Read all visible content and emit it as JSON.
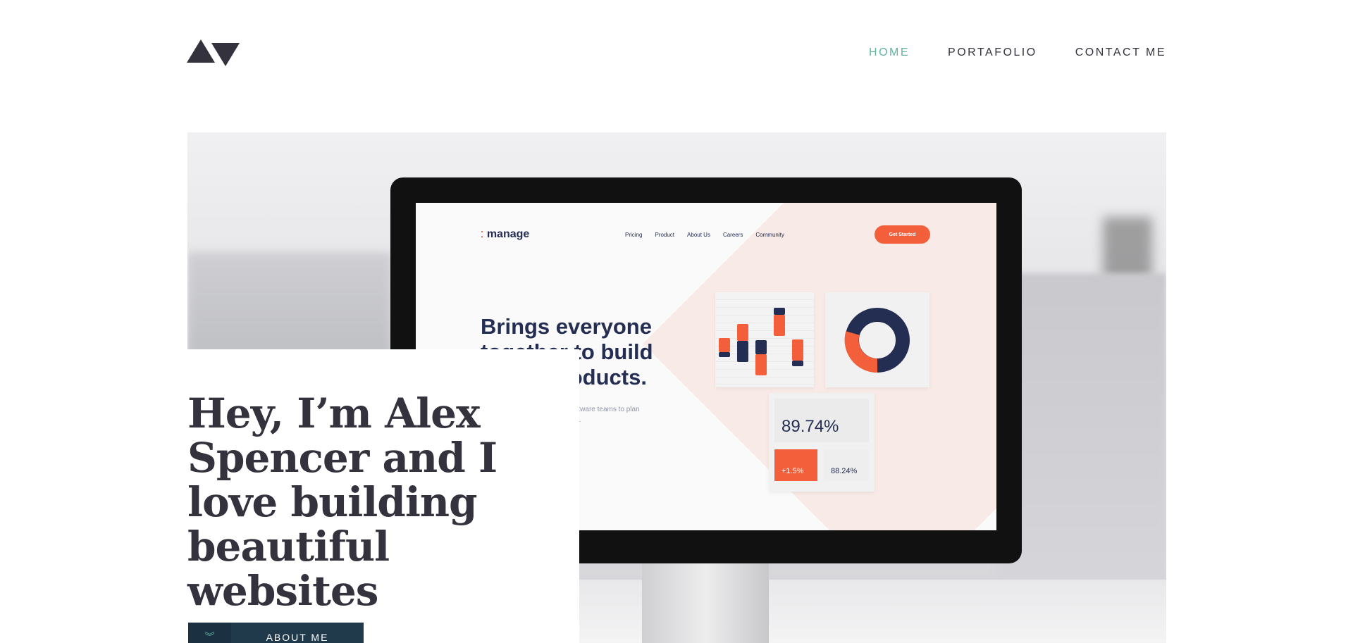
{
  "nav": {
    "items": [
      {
        "label": "HOME",
        "active": true
      },
      {
        "label": "PORTAFOLIO",
        "active": false
      },
      {
        "label": "CONTACT ME",
        "active": false
      }
    ]
  },
  "hero": {
    "title": "Hey, I’m Alex Spencer and I love building beautiful websites",
    "about_button": "ABOUT ME"
  },
  "mockup": {
    "brand": "manage",
    "nav": [
      "Pricing",
      "Product",
      "About Us",
      "Careers",
      "Community"
    ],
    "cta": "Get Started",
    "headline": "Brings everyone together to build better products.",
    "body": "Manage makes it simple for software teams to plan day-to-day tasks are in one tool.",
    "stat_main": "89.74%",
    "stat_change": "+1.5%",
    "stat_secondary": "88.24%"
  },
  "colors": {
    "accent": "#5fb4a2",
    "text": "#33323d",
    "button": "#203a4c",
    "mockup_orange": "#f25f3a",
    "mockup_navy": "#242d52"
  },
  "icons": [
    "logo-triangles-icon",
    "chevron-down-icon",
    "apple-icon"
  ]
}
